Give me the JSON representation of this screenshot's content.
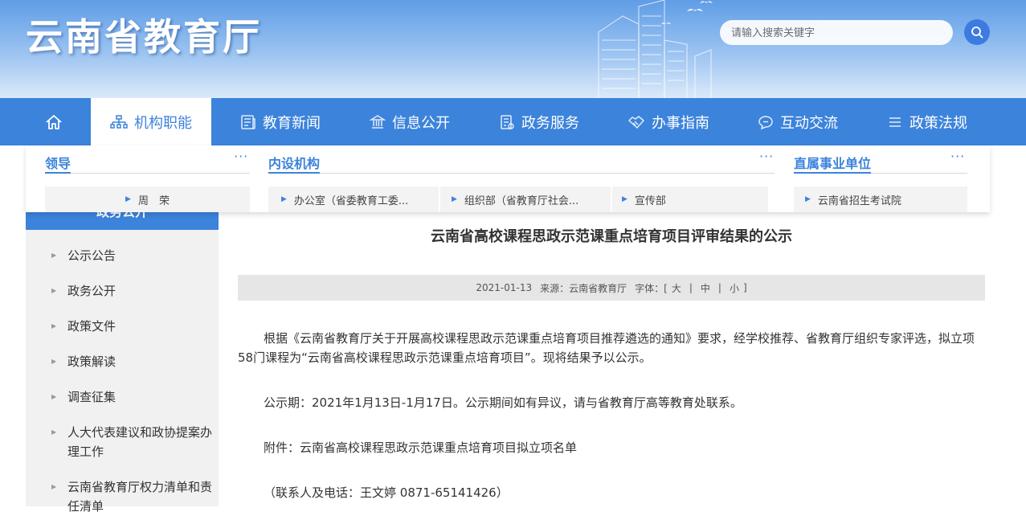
{
  "header": {
    "site_title": "云南省教育厅",
    "search_placeholder": "请输入搜索关键字"
  },
  "nav": {
    "items": [
      {
        "label": "机构职能"
      },
      {
        "label": "教育新闻"
      },
      {
        "label": "信息公开"
      },
      {
        "label": "政务服务"
      },
      {
        "label": "办事指南"
      },
      {
        "label": "互动交流"
      },
      {
        "label": "政策法规"
      }
    ]
  },
  "submenu": {
    "more": "···",
    "groups": [
      {
        "title": "领导",
        "links": [
          "周　荣"
        ]
      },
      {
        "title": "内设机构",
        "links": [
          "办公室（省委教育工委...",
          "组织部（省教育厅社会...",
          "宣传部"
        ]
      },
      {
        "title": "直属事业单位",
        "links": [
          "云南省招生考试院"
        ]
      }
    ]
  },
  "sidebar": {
    "heading": "政务公开",
    "items": [
      "公示公告",
      "政务公开",
      "政策文件",
      "政策解读",
      "调查征集",
      "人大代表建议和政协提案办理工作",
      "云南省教育厅权力清单和责任清单"
    ]
  },
  "article": {
    "title": "云南省高校课程思政示范课重点培育项目评审结果的公示",
    "date": "2021-01-13",
    "source": "来源：云南省教育厅",
    "fontsize_label": "字体：[",
    "fs_large": "大",
    "fs_mid": "中",
    "fs_small": "小",
    "sep": "|",
    "close": "]",
    "paragraphs": [
      "根据《云南省教育厅关于开展高校课程思政示范课重点培育项目推荐遴选的通知》要求，经学校推荐、省教育厅组织专家评选，拟立项58门课程为“云南省高校课程思政示范课重点培育项目”。现将结果予以公示。",
      "公示期：2021年1月13日-1月17日。公示期间如有异议，请与省教育厅高等教育处联系。",
      "附件：云南省高校课程思政示范课重点培育项目拟立项名单",
      "（联系人及电话：王文婷 0871-65141426）"
    ]
  },
  "colors": {
    "primary": "#3c83db",
    "header_top": "#5f9de6",
    "header_bottom": "#dbe9fa"
  }
}
